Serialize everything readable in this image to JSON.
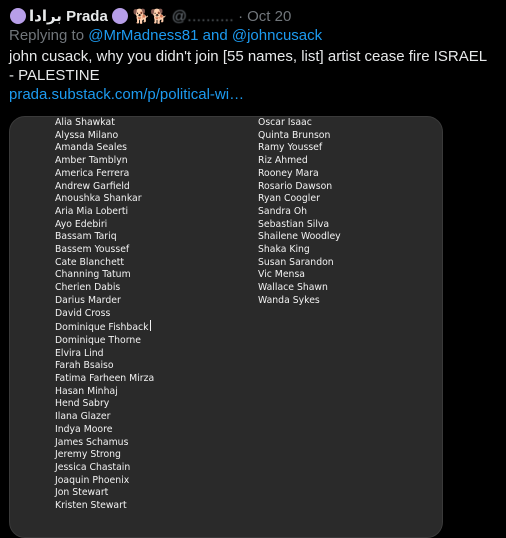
{
  "tweet": {
    "display_name": "برادا Prada",
    "handle_blurred": "@..........",
    "date": "Oct 20",
    "replying_to_prefix": "Replying to",
    "mention_1": "@MrMadness81",
    "and_text": "and",
    "mention_2": "@johncusack",
    "text": "john cusack, why you didn't join [55 names, list] artist cease fire ISRAEL - PALESTINE",
    "link": "prada.substack.com/p/political-wi…"
  },
  "names_left": [
    "Alia Shawkat",
    "Alyssa Milano",
    "Amanda Seales",
    "Amber Tamblyn",
    "America Ferrera",
    "Andrew Garfield",
    "Anoushka Shankar",
    "Aria Mia Loberti",
    "Ayo Edebiri",
    "Bassam Tariq",
    "Bassem Youssef",
    "Cate Blanchett",
    "Channing Tatum",
    "Cherien Dabis",
    "Darius Marder",
    "David Cross",
    "Dominique Fishback",
    "Dominique Thorne",
    "Elvira Lind",
    "Farah Bsaiso",
    "Fatima Farheen Mirza",
    "Hasan Minhaj",
    "Hend Sabry",
    "Ilana Glazer",
    "Indya Moore",
    "James Schamus",
    "Jeremy Strong",
    "Jessica Chastain",
    "Joaquin Phoenix",
    "Jon Stewart",
    "Kristen Stewart"
  ],
  "names_right": [
    "Oscar Isaac",
    "Quinta Brunson",
    "Ramy Youssef",
    "Riz Ahmed",
    "Rooney Mara",
    "Rosario Dawson",
    "Ryan Coogler",
    "Sandra Oh",
    "Sebastian Silva",
    "Shailene Woodley",
    "Shaka King",
    "Susan Sarandon",
    "Vic Mensa",
    "Wallace Shawn",
    "Wanda Sykes"
  ]
}
